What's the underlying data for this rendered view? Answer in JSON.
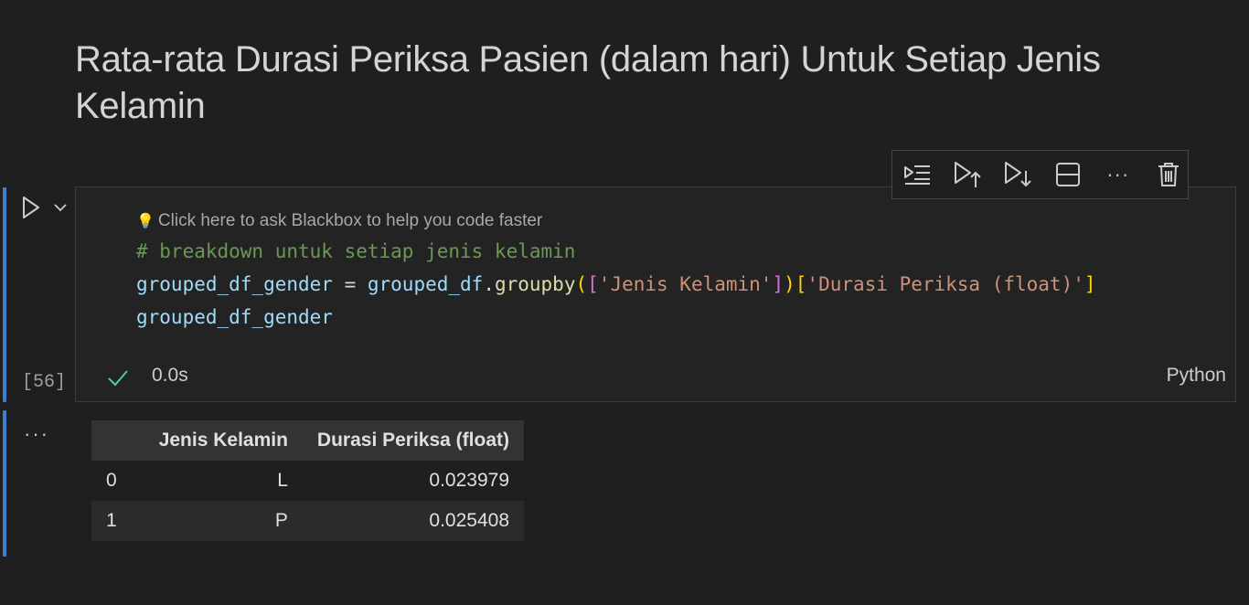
{
  "markdown": {
    "heading": "Rata-rata Durasi Periksa Pasien (dalam hari) Untuk Setiap Jenis Kelamin"
  },
  "cell": {
    "execution_count": "[56]",
    "hint_text": "Click here to ask Blackbox to help you code faster",
    "code_lines": [
      "# breakdown untuk setiap jenis kelamin",
      "grouped_df_gender = grouped_df.groupby(['Jenis Kelamin'])['Durasi Periksa (float)']",
      "grouped_df_gender"
    ],
    "tokens": {
      "line2": {
        "var1": "grouped_df_gender",
        "eq": " = ",
        "var2": "grouped_df",
        "dot": ".",
        "func": "groupby",
        "lparen": "(",
        "lbrack": "[",
        "str1": "'Jenis Kelamin'",
        "rbrack": "]",
        "rparen": ")",
        "lbrack2": "[",
        "str2": "'Durasi Periksa (float)'",
        "rbrack2": "]"
      }
    },
    "status": {
      "time": "0.0s",
      "language": "Python",
      "success": true
    }
  },
  "toolbar": {
    "items": [
      "execute-above-and-cell-icon",
      "run-above-icon",
      "run-below-icon",
      "split-cell-icon",
      "more-actions-icon",
      "delete-cell-icon"
    ],
    "more_label": "···"
  },
  "output": {
    "more_label": "···",
    "table": {
      "columns": [
        "",
        "Jenis Kelamin",
        "Durasi Periksa (float)"
      ],
      "rows": [
        [
          "0",
          "L",
          "0.023979"
        ],
        [
          "1",
          "P",
          "0.025408"
        ]
      ]
    }
  },
  "colors": {
    "background": "#1f1f1f",
    "focus_bar": "#3c7fd1",
    "comment": "#6a9955",
    "variable": "#9cdcfe",
    "function": "#dcdcaa",
    "string": "#ce9178",
    "success_check": "#4ec9b0"
  }
}
